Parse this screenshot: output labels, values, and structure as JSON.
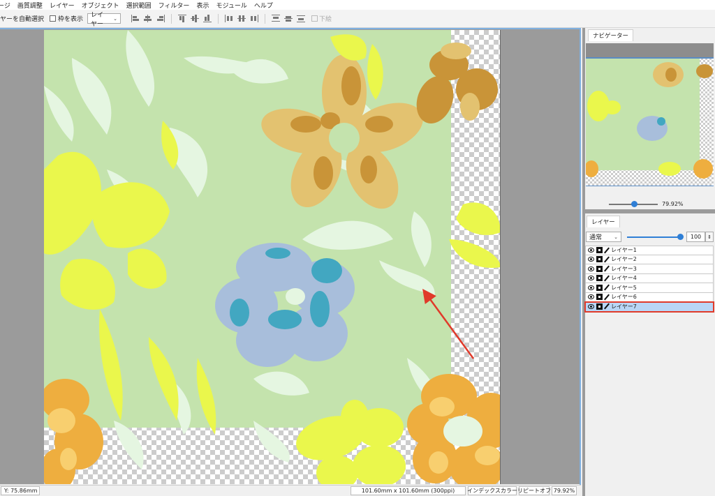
{
  "menu": [
    "ージ",
    "画質調整",
    "レイヤー",
    "オブジェクト",
    "選択範囲",
    "フィルター",
    "表示",
    "モジュール",
    "ヘルプ"
  ],
  "toolbar": {
    "auto_select_label": "ヤーを自動選択",
    "show_frame_label": "枠を表示",
    "layer_select_value": "レイヤー",
    "lower_label": "下絵"
  },
  "panels": {
    "navigator_tab": "ナビゲーター",
    "navigator_zoom": "79.92%",
    "layers_tab": "レイヤー",
    "blend_mode": "通常",
    "opacity": "100"
  },
  "layers": [
    {
      "name": "レイヤー1",
      "selected": false
    },
    {
      "name": "レイヤー2",
      "selected": false
    },
    {
      "name": "レイヤー3",
      "selected": false
    },
    {
      "name": "レイヤー4",
      "selected": false
    },
    {
      "name": "レイヤー5",
      "selected": false
    },
    {
      "name": "レイヤー6",
      "selected": false
    },
    {
      "name": "レイヤー7",
      "selected": true
    }
  ],
  "status": {
    "y_coord": "Y:   75.86mm",
    "doc_size": "101.60mm x 101.60mm (300ppi)",
    "color_mode": "インデックスカラー",
    "repeat": "リピートオフ",
    "zoom": "79.92%"
  },
  "colors": {
    "background_green": "#c4e3ad",
    "leaf_pale": "#e5f6e1",
    "yellow": "#eaf74c",
    "tan_light": "#e3c270",
    "tan_dark": "#c99438",
    "blue_light": "#a8bedb",
    "blue_dark": "#42a7c1",
    "orange_light": "#f8cf6f",
    "orange_dark": "#eeae3f",
    "annotation_red": "#e03a2a",
    "selection_blue": "#b9d6f6"
  }
}
